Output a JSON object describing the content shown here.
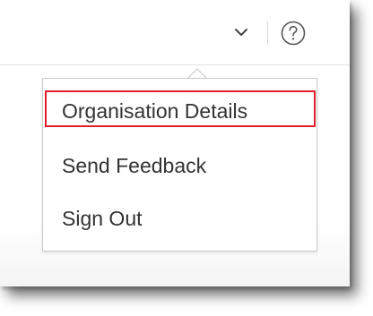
{
  "topbar": {
    "dropdown_icon": "chevron-down-icon",
    "help_icon": "question-circle-icon"
  },
  "menu": {
    "items": [
      {
        "label": "Organisation Details",
        "highlighted": true
      },
      {
        "label": "Send Feedback",
        "highlighted": false
      },
      {
        "label": "Sign Out",
        "highlighted": false
      }
    ]
  },
  "colors": {
    "highlight_border": "#e0202a",
    "menu_text": "#333333",
    "menu_border": "#c9c9c9"
  }
}
